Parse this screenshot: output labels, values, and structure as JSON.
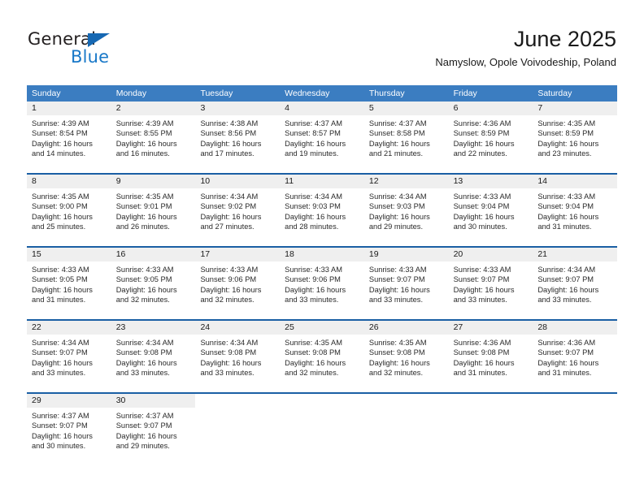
{
  "branding": {
    "logo_text_primary": "General",
    "logo_text_secondary": "Blue",
    "logo_accent_color": "#1668b3",
    "logo_secondary_color": "#1878c8"
  },
  "header": {
    "month_title": "June 2025",
    "location": "Namyslow, Opole Voivodeship, Poland"
  },
  "theme": {
    "header_background": "#3b7dc1",
    "header_text": "#ffffff",
    "week_separator": "#1a5fa4",
    "day_number_background": "#efefef",
    "body_text": "#2a2a2a"
  },
  "calendar": {
    "weekdays": [
      "Sunday",
      "Monday",
      "Tuesday",
      "Wednesday",
      "Thursday",
      "Friday",
      "Saturday"
    ],
    "weeks": [
      [
        {
          "day": "1",
          "sunrise": "Sunrise: 4:39 AM",
          "sunset": "Sunset: 8:54 PM",
          "daylight": "Daylight: 16 hours and 14 minutes."
        },
        {
          "day": "2",
          "sunrise": "Sunrise: 4:39 AM",
          "sunset": "Sunset: 8:55 PM",
          "daylight": "Daylight: 16 hours and 16 minutes."
        },
        {
          "day": "3",
          "sunrise": "Sunrise: 4:38 AM",
          "sunset": "Sunset: 8:56 PM",
          "daylight": "Daylight: 16 hours and 17 minutes."
        },
        {
          "day": "4",
          "sunrise": "Sunrise: 4:37 AM",
          "sunset": "Sunset: 8:57 PM",
          "daylight": "Daylight: 16 hours and 19 minutes."
        },
        {
          "day": "5",
          "sunrise": "Sunrise: 4:37 AM",
          "sunset": "Sunset: 8:58 PM",
          "daylight": "Daylight: 16 hours and 21 minutes."
        },
        {
          "day": "6",
          "sunrise": "Sunrise: 4:36 AM",
          "sunset": "Sunset: 8:59 PM",
          "daylight": "Daylight: 16 hours and 22 minutes."
        },
        {
          "day": "7",
          "sunrise": "Sunrise: 4:35 AM",
          "sunset": "Sunset: 8:59 PM",
          "daylight": "Daylight: 16 hours and 23 minutes."
        }
      ],
      [
        {
          "day": "8",
          "sunrise": "Sunrise: 4:35 AM",
          "sunset": "Sunset: 9:00 PM",
          "daylight": "Daylight: 16 hours and 25 minutes."
        },
        {
          "day": "9",
          "sunrise": "Sunrise: 4:35 AM",
          "sunset": "Sunset: 9:01 PM",
          "daylight": "Daylight: 16 hours and 26 minutes."
        },
        {
          "day": "10",
          "sunrise": "Sunrise: 4:34 AM",
          "sunset": "Sunset: 9:02 PM",
          "daylight": "Daylight: 16 hours and 27 minutes."
        },
        {
          "day": "11",
          "sunrise": "Sunrise: 4:34 AM",
          "sunset": "Sunset: 9:03 PM",
          "daylight": "Daylight: 16 hours and 28 minutes."
        },
        {
          "day": "12",
          "sunrise": "Sunrise: 4:34 AM",
          "sunset": "Sunset: 9:03 PM",
          "daylight": "Daylight: 16 hours and 29 minutes."
        },
        {
          "day": "13",
          "sunrise": "Sunrise: 4:33 AM",
          "sunset": "Sunset: 9:04 PM",
          "daylight": "Daylight: 16 hours and 30 minutes."
        },
        {
          "day": "14",
          "sunrise": "Sunrise: 4:33 AM",
          "sunset": "Sunset: 9:04 PM",
          "daylight": "Daylight: 16 hours and 31 minutes."
        }
      ],
      [
        {
          "day": "15",
          "sunrise": "Sunrise: 4:33 AM",
          "sunset": "Sunset: 9:05 PM",
          "daylight": "Daylight: 16 hours and 31 minutes."
        },
        {
          "day": "16",
          "sunrise": "Sunrise: 4:33 AM",
          "sunset": "Sunset: 9:05 PM",
          "daylight": "Daylight: 16 hours and 32 minutes."
        },
        {
          "day": "17",
          "sunrise": "Sunrise: 4:33 AM",
          "sunset": "Sunset: 9:06 PM",
          "daylight": "Daylight: 16 hours and 32 minutes."
        },
        {
          "day": "18",
          "sunrise": "Sunrise: 4:33 AM",
          "sunset": "Sunset: 9:06 PM",
          "daylight": "Daylight: 16 hours and 33 minutes."
        },
        {
          "day": "19",
          "sunrise": "Sunrise: 4:33 AM",
          "sunset": "Sunset: 9:07 PM",
          "daylight": "Daylight: 16 hours and 33 minutes."
        },
        {
          "day": "20",
          "sunrise": "Sunrise: 4:33 AM",
          "sunset": "Sunset: 9:07 PM",
          "daylight": "Daylight: 16 hours and 33 minutes."
        },
        {
          "day": "21",
          "sunrise": "Sunrise: 4:34 AM",
          "sunset": "Sunset: 9:07 PM",
          "daylight": "Daylight: 16 hours and 33 minutes."
        }
      ],
      [
        {
          "day": "22",
          "sunrise": "Sunrise: 4:34 AM",
          "sunset": "Sunset: 9:07 PM",
          "daylight": "Daylight: 16 hours and 33 minutes."
        },
        {
          "day": "23",
          "sunrise": "Sunrise: 4:34 AM",
          "sunset": "Sunset: 9:08 PM",
          "daylight": "Daylight: 16 hours and 33 minutes."
        },
        {
          "day": "24",
          "sunrise": "Sunrise: 4:34 AM",
          "sunset": "Sunset: 9:08 PM",
          "daylight": "Daylight: 16 hours and 33 minutes."
        },
        {
          "day": "25",
          "sunrise": "Sunrise: 4:35 AM",
          "sunset": "Sunset: 9:08 PM",
          "daylight": "Daylight: 16 hours and 32 minutes."
        },
        {
          "day": "26",
          "sunrise": "Sunrise: 4:35 AM",
          "sunset": "Sunset: 9:08 PM",
          "daylight": "Daylight: 16 hours and 32 minutes."
        },
        {
          "day": "27",
          "sunrise": "Sunrise: 4:36 AM",
          "sunset": "Sunset: 9:08 PM",
          "daylight": "Daylight: 16 hours and 31 minutes."
        },
        {
          "day": "28",
          "sunrise": "Sunrise: 4:36 AM",
          "sunset": "Sunset: 9:07 PM",
          "daylight": "Daylight: 16 hours and 31 minutes."
        }
      ],
      [
        {
          "day": "29",
          "sunrise": "Sunrise: 4:37 AM",
          "sunset": "Sunset: 9:07 PM",
          "daylight": "Daylight: 16 hours and 30 minutes."
        },
        {
          "day": "30",
          "sunrise": "Sunrise: 4:37 AM",
          "sunset": "Sunset: 9:07 PM",
          "daylight": "Daylight: 16 hours and 29 minutes."
        },
        {
          "day": "",
          "sunrise": "",
          "sunset": "",
          "daylight": ""
        },
        {
          "day": "",
          "sunrise": "",
          "sunset": "",
          "daylight": ""
        },
        {
          "day": "",
          "sunrise": "",
          "sunset": "",
          "daylight": ""
        },
        {
          "day": "",
          "sunrise": "",
          "sunset": "",
          "daylight": ""
        },
        {
          "day": "",
          "sunrise": "",
          "sunset": "",
          "daylight": ""
        }
      ]
    ]
  }
}
